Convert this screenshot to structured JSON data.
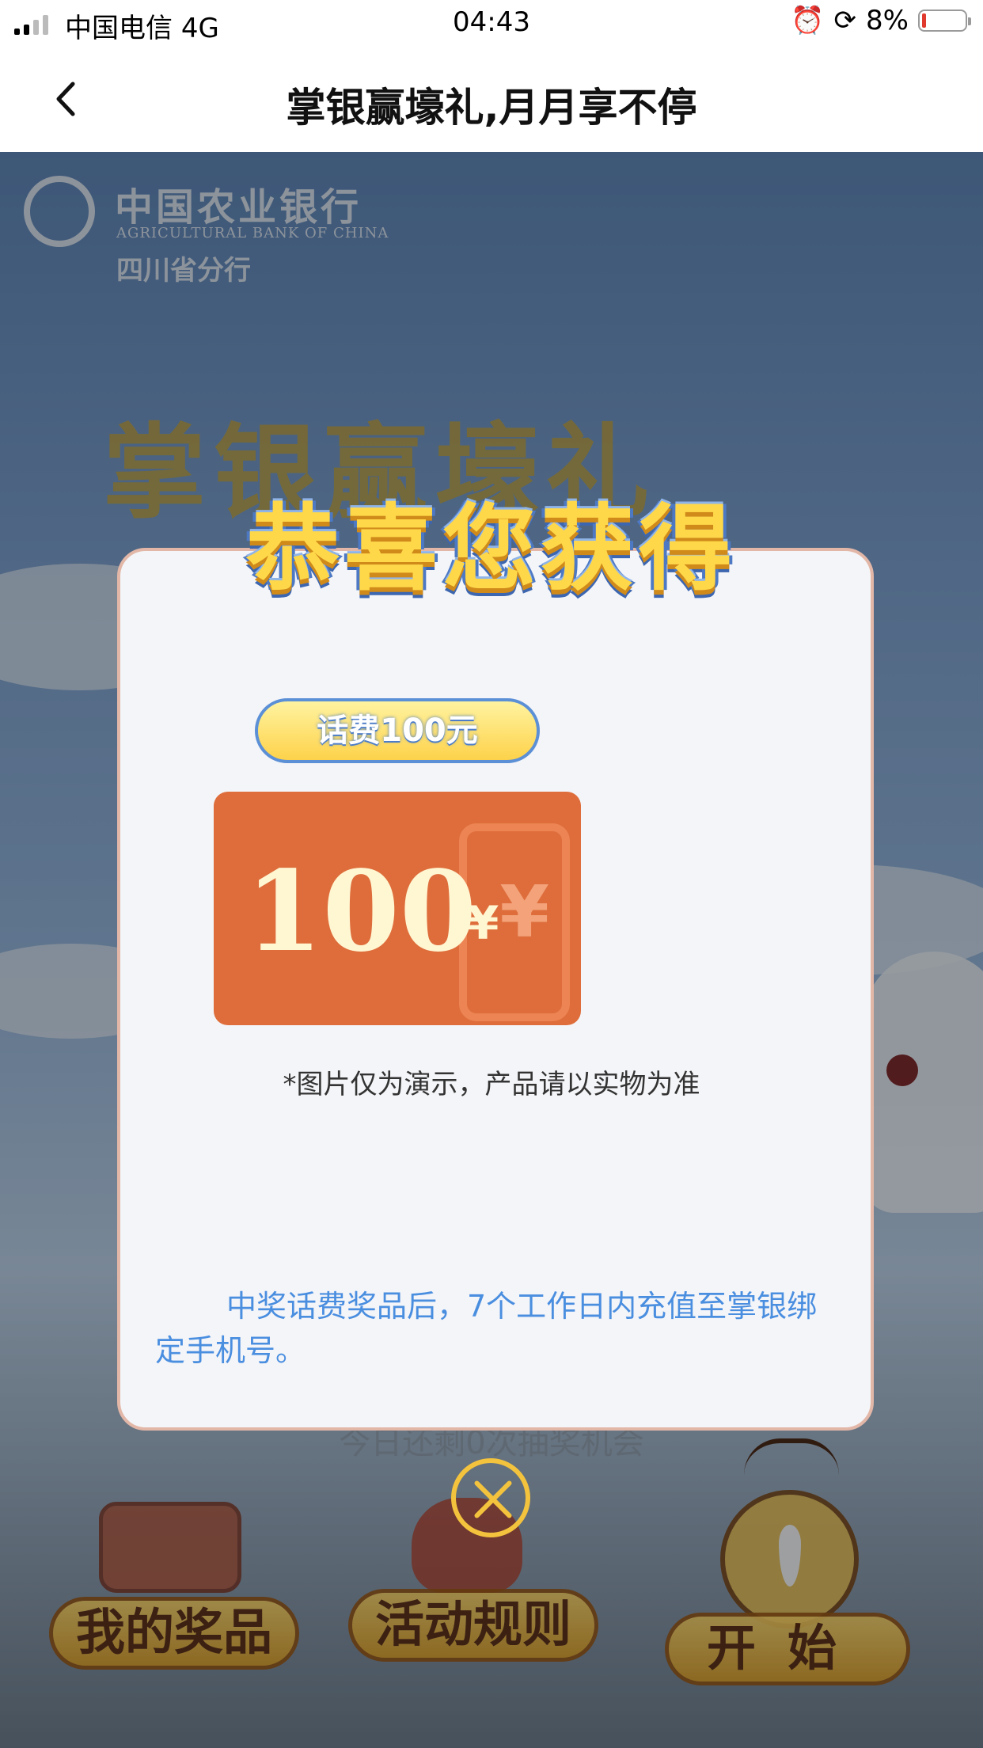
{
  "status_bar": {
    "carrier": "中国电信",
    "network": "4G",
    "time": "04:43",
    "battery_percent": "8%"
  },
  "nav": {
    "title": "掌银赢壕礼,月月享不停"
  },
  "background": {
    "bank_name_cn": "中国农业银行",
    "bank_name_en": "AGRICULTURAL BANK OF CHINA",
    "branch": "四川省分行",
    "campaign_title": "掌银赢壕礼",
    "remaining_hint": "今日还剩0次抽奖机会",
    "buttons": {
      "my_prizes": "我的奖品",
      "rules": "活动规则",
      "start": "开始"
    }
  },
  "modal": {
    "header": "恭喜您获得",
    "prize_name": "话费100元",
    "card_amount": "100",
    "card_currency": "¥",
    "disclaimer": "*图片仅为演示，产品请以实物为准",
    "note": "中奖话费奖品后，7个工作日内充值至掌银绑定手机号。"
  },
  "colors": {
    "accent_yellow": "#ffd84a",
    "card_orange": "#de6d3b",
    "note_blue": "#4a8ee0"
  },
  "icons": {
    "back": "chevron-left-icon",
    "close": "close-circle-icon"
  }
}
